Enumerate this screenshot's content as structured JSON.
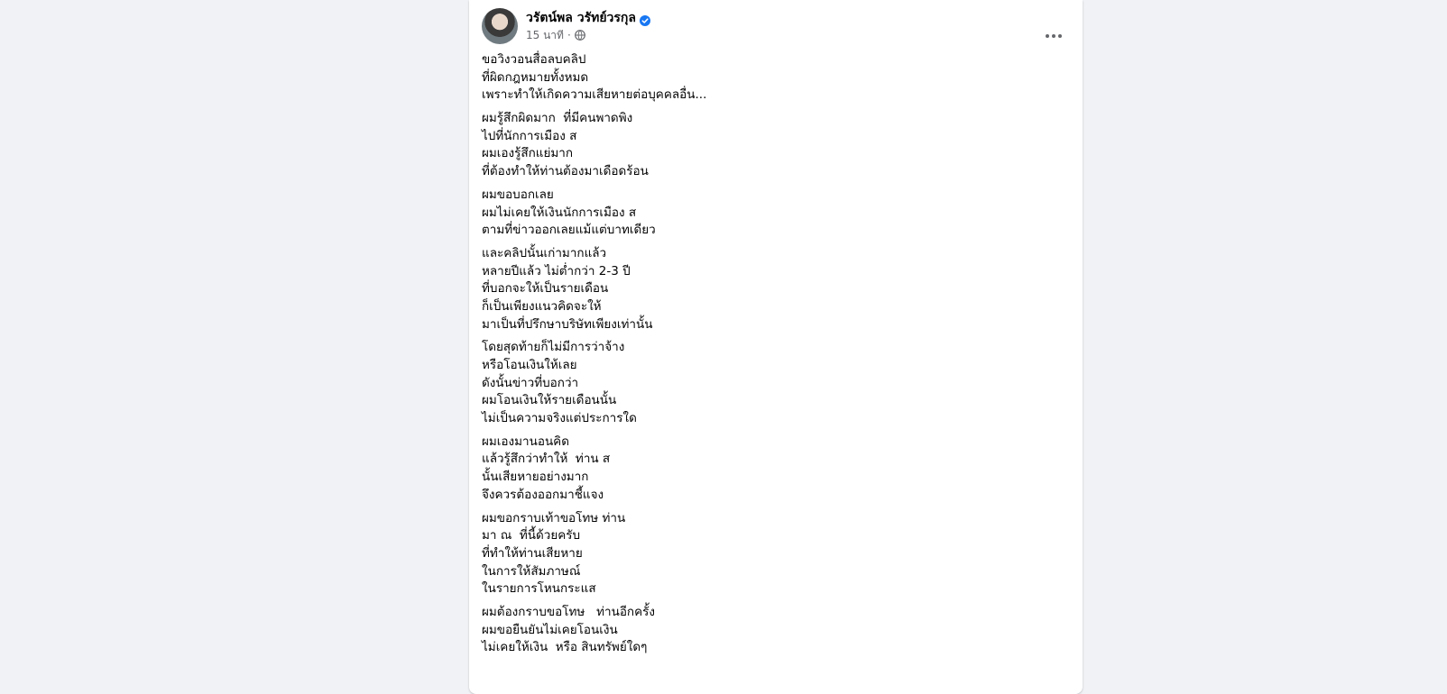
{
  "post": {
    "author": {
      "name": "วรัตน์พล วรัทย์วรกุล",
      "verified_icon": "verified-badge-icon",
      "avatar_icon": "profile-photo"
    },
    "timestamp": "15 นาที",
    "separator": "·",
    "audience_icon": "globe-icon",
    "more_icon": "more-options-icon",
    "paragraphs": [
      {
        "lines": [
          "ขอวิงวอนสื่อลบคลิป",
          "ที่ผิดกฎหมายทั้งหมด",
          "เพราะทำให้เกิดความเสียหายต่อบุคคลอื่น..."
        ]
      },
      {
        "lines": [
          "ผมรู้สึกผิดมาก  ที่มีคนพาดพิง",
          "ไปที่นักการเมือง ส",
          "ผมเองรู้สึกแย่มาก",
          "ที่ต้องทำให้ท่านต้องมาเดือดร้อน"
        ]
      },
      {
        "lines": [
          "ผมขอบอกเลย",
          "ผมไม่เคยให้เงินนักการเมือง ส",
          "ตามที่ข่าวออกเลยแม้แต่บาทเดียว"
        ]
      },
      {
        "lines": [
          "และคลิปนั้นเก่ามากแล้ว",
          "หลายปีแล้ว ไม่ต่ำกว่า 2-3 ปี",
          "ที่บอกจะให้เป็นรายเดือน",
          "ก็เป็นเพียงแนวคิดจะให้",
          "มาเป็นที่ปรึกษาบริษัทเพียงเท่านั้น"
        ]
      },
      {
        "lines": [
          "โดยสุดท้ายก็ไม่มีการว่าจ้าง",
          "หรือโอนเงินให้เลย",
          "ดังนั้นข่าวที่บอกว่า",
          "ผมโอนเงินให้รายเดือนนั้น",
          "ไม่เป็นความจริงแต่ประการใด"
        ]
      },
      {
        "lines": [
          "ผมเองมานอนคิด",
          "แล้วรู้สึกว่าทำให้  ท่าน ส",
          "นั้นเสียหายอย่างมาก",
          "จึงควรต้องออกมาชี้แจง"
        ]
      },
      {
        "lines": [
          "ผมขอกราบเท้าขอโทษ ท่าน",
          "มา ณ  ที่นี้ด้วยครับ",
          "ที่ทำให้ท่านเสียหาย",
          "ในการให้สัมภาษณ์",
          "ในรายการโหนกระแส"
        ]
      },
      {
        "lines": [
          "ผมต้องกราบขอโทษ   ท่านอีกครั้ง",
          "ผมขอยืนยันไม่เคยโอนเงิน",
          "ไม่เคยให้เงิน  หรือ สินทรัพย์ใดๆ"
        ]
      }
    ]
  }
}
